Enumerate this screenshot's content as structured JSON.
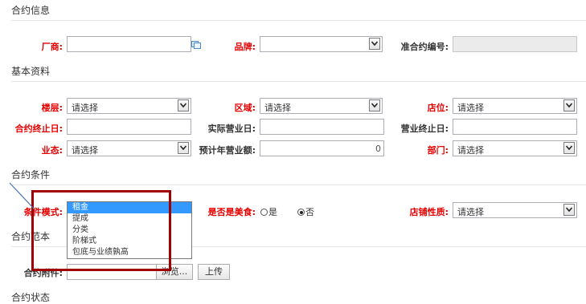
{
  "sections": {
    "contract_info": "合约信息",
    "basic_info": "基本资料",
    "contract_terms": "合约条件",
    "contract_template": "合约范本",
    "contract_status": "合约状态"
  },
  "row1": {
    "vendor_label": "厂商:",
    "brand_label": "品牌:",
    "pre_contract_label": "准合约编号:"
  },
  "row2": {
    "floor_label": "楼层:",
    "floor_value": "请选择",
    "area_label": "区域:",
    "area_value": "请选择",
    "shop_label": "店位:",
    "shop_value": "请选择"
  },
  "row3": {
    "end_date_label": "合约终止日:",
    "open_date_label": "实际营业日:",
    "close_date_label": "营业终止日:"
  },
  "row4": {
    "format_label": "业态:",
    "format_value": "请选择",
    "forecast_label": "预计年营业额:",
    "forecast_value": "0",
    "dept_label": "部门:",
    "dept_value": "请选择"
  },
  "terms": {
    "mode_label": "条件模式:",
    "mode_options": [
      "租金",
      "提成",
      "分类",
      "阶梯式",
      "包底与业绩孰高"
    ],
    "food_label": "是否是美食:",
    "food_yes": "是",
    "food_no": "否",
    "shop_nature_label": "店铺性质:",
    "shop_nature_value": "请选择"
  },
  "template": {
    "attach_label": "合约附件:",
    "browse_label": "浏览...",
    "upload_label": "上传"
  },
  "colors": {
    "required_label": "#e60000",
    "highlight_box": "#a00000",
    "selected_option": "#3399ff"
  }
}
